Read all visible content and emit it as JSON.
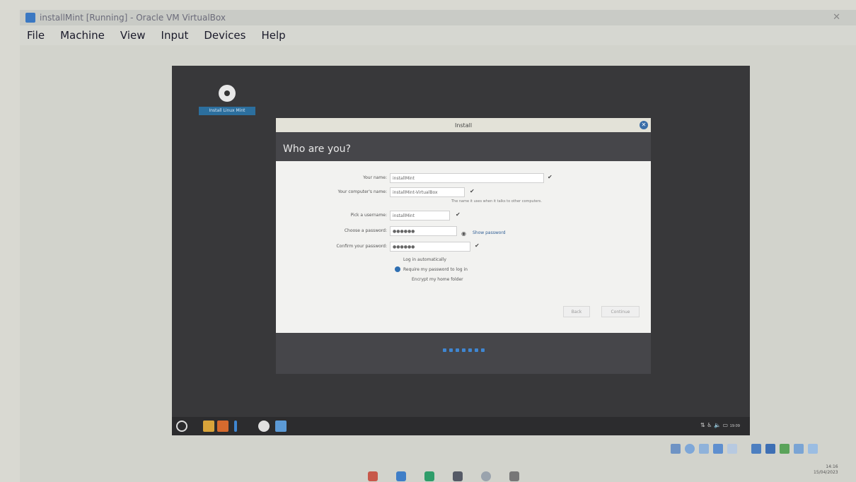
{
  "host": {
    "window_title": "installMint [Running] - Oracle VM VirtualBox",
    "menu": [
      "File",
      "Machine",
      "View",
      "Input",
      "Devices",
      "Help"
    ]
  },
  "guest": {
    "desktop_icon_label": "Install Linux Mint",
    "installer": {
      "window_title": "Install",
      "page_title": "Who are you?",
      "fields": {
        "name": {
          "label": "Your name:",
          "value": "installMint"
        },
        "computer_name": {
          "label": "Your computer's name:",
          "value": "installMint-VirtualBox",
          "hint": "The name it uses when it talks to other computers."
        },
        "username": {
          "label": "Pick a username:",
          "value": "installMint"
        },
        "password": {
          "label": "Choose a password:",
          "value": "●●●●●●"
        },
        "confirm_password": {
          "label": "Confirm your password:",
          "value": "●●●●●●"
        }
      },
      "show_password_label": "Show password",
      "options": {
        "login_auto": "Log in automatically",
        "require_password": "Require my password to log in",
        "encrypt_home": "Encrypt my home folder"
      },
      "buttons": {
        "back": "Back",
        "continue": "Continue"
      },
      "progress": {
        "total_steps": 7
      }
    },
    "panel": {
      "clock": "19:09"
    }
  },
  "host_taskbar": {
    "clock_time": "14:16",
    "clock_date": "15/04/2023"
  },
  "colors": {
    "accent": "#3f86d1",
    "guest_bg": "#38383a",
    "installer_bg": "#46464a"
  }
}
